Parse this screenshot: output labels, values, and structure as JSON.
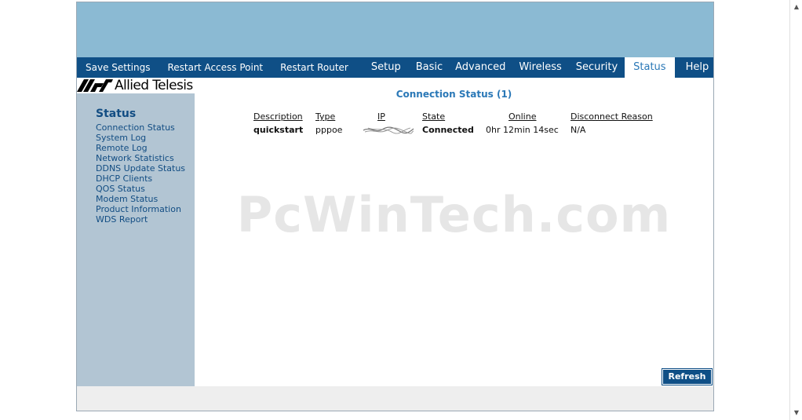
{
  "nav": {
    "items": [
      {
        "label": "Save Settings",
        "active": false,
        "small": true
      },
      {
        "label": "Restart Access Point",
        "active": false,
        "small": true
      },
      {
        "label": "Restart Router",
        "active": false,
        "small": true
      },
      {
        "label": "Setup",
        "active": false
      },
      {
        "label": "Basic",
        "active": false
      },
      {
        "label": "Advanced",
        "active": false
      },
      {
        "label": "Wireless",
        "active": false
      },
      {
        "label": "Security",
        "active": false
      },
      {
        "label": "Status",
        "active": true
      },
      {
        "label": "Help",
        "active": false
      }
    ]
  },
  "logo": {
    "text": "Allied Telesis"
  },
  "sidebar": {
    "title": "Status",
    "links": [
      "Connection Status",
      "System Log",
      "Remote Log",
      "Network Statistics",
      "DDNS Update Status",
      "DHCP Clients",
      "QOS Status",
      "Modem Status",
      "Product Information",
      "WDS Report"
    ]
  },
  "main": {
    "title": "Connection Status (1)",
    "columns": {
      "description": "Description",
      "type": "Type",
      "ip": "IP",
      "state": "State",
      "online": "Online",
      "disconnect_reason": "Disconnect Reason"
    },
    "row": {
      "description": "quickstart",
      "type": "pppoe",
      "ip": "",
      "state": "Connected",
      "online": "0hr 12min 14sec",
      "disconnect_reason": "N/A"
    },
    "refresh_label": "Refresh"
  },
  "watermark": "PcWinTech.com",
  "colors": {
    "banner": "#8bbad3",
    "nav_bg": "#0f4f86",
    "sidebar_bg": "#b2c5d3",
    "link": "#124d83",
    "accent": "#2a78b7"
  }
}
